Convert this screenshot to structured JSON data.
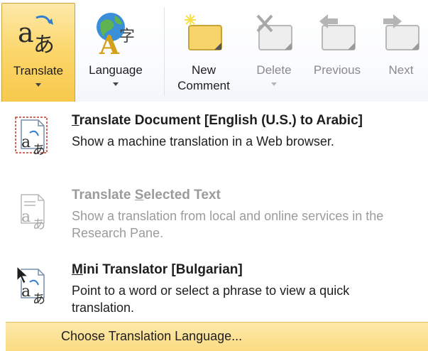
{
  "ribbon": {
    "translate": {
      "label": "Translate",
      "icon": "translate-icon"
    },
    "language": {
      "label": "Language",
      "icon": "language-icon"
    },
    "new_comment": {
      "label_line1": "New",
      "label_line2": "Comment",
      "icon": "new-comment-icon"
    },
    "delete": {
      "label": "Delete",
      "icon": "delete-comment-icon"
    },
    "previous": {
      "label": "Previous",
      "icon": "previous-comment-icon"
    },
    "next": {
      "label": "Next",
      "icon": "next-comment-icon"
    },
    "translate_icon_glyphs": {
      "latin": "a",
      "kana": "あ"
    },
    "language_icon_glyphs": {
      "latin": "A",
      "kanji": "字"
    }
  },
  "menu": {
    "translate_document": {
      "title_prefix": "",
      "title_accel": "T",
      "title_rest": "ranslate Document [English (U.S.) to Arabic]",
      "description": "Show a machine translation in a Web browser.",
      "icon": "translate-document-icon"
    },
    "translate_selected": {
      "title_prefix": "Translate ",
      "title_accel": "S",
      "title_rest": "elected Text",
      "description": "Show a translation from local and online services in the Research Pane.",
      "icon": "translate-selected-icon"
    },
    "mini_translator": {
      "title_prefix": "",
      "title_accel": "M",
      "title_rest": "ini Translator [Bulgarian]",
      "description": "Point to a word or select a phrase to view a quick translation.",
      "icon": "mini-translator-icon"
    },
    "choose_language": {
      "label": "Choose Translation Language..."
    }
  },
  "colors": {
    "highlight_top": "#fde9a9",
    "highlight_bottom": "#f8c94d",
    "disabled_text": "#9b9b9b",
    "text": "#1e1e1e"
  }
}
